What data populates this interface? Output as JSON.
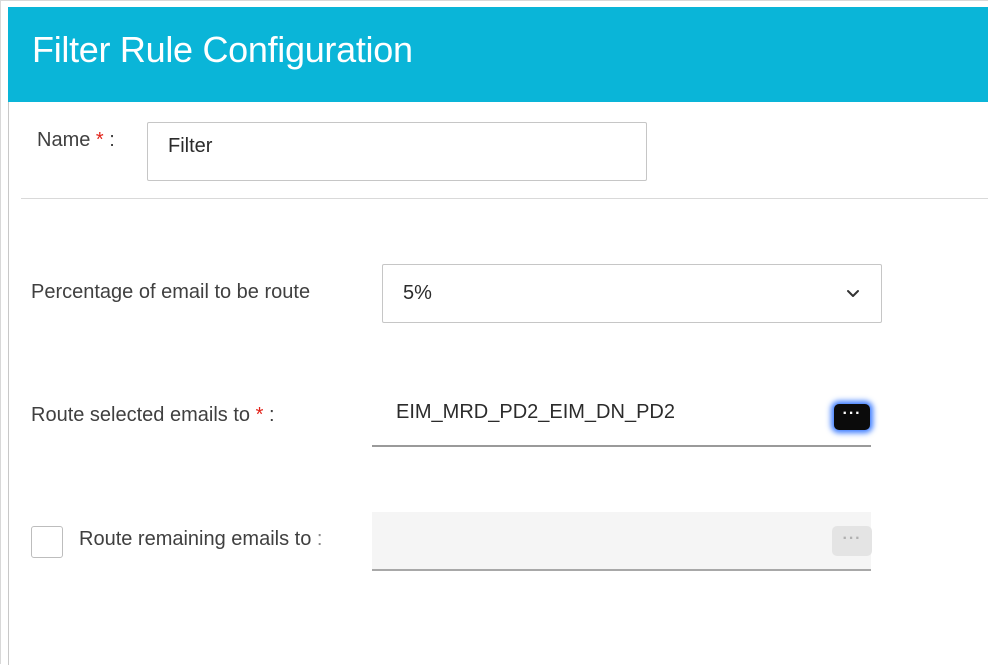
{
  "header": {
    "title": "Filter Rule Configuration"
  },
  "name_field": {
    "label": "Name",
    "required_marker": "*",
    "separator": ":",
    "value": "Filter"
  },
  "percentage_field": {
    "label": "Percentage of email to be route",
    "selected_value": "5%",
    "dropdown_icon": "chevron-down-icon"
  },
  "route_selected_field": {
    "label": "Route selected emails to",
    "required_marker": "*",
    "separator": ":",
    "value": "EIM_MRD_PD2_EIM_DN_PD2",
    "browse_button_label": "···"
  },
  "route_remaining_field": {
    "label": "Route remaining emails to",
    "separator": ":",
    "checked": false,
    "value": "",
    "browse_button_label": "···"
  },
  "colors": {
    "header_bg": "#0ab5d8",
    "required": "#e2231a",
    "focus_glow": "#3b7bff"
  }
}
